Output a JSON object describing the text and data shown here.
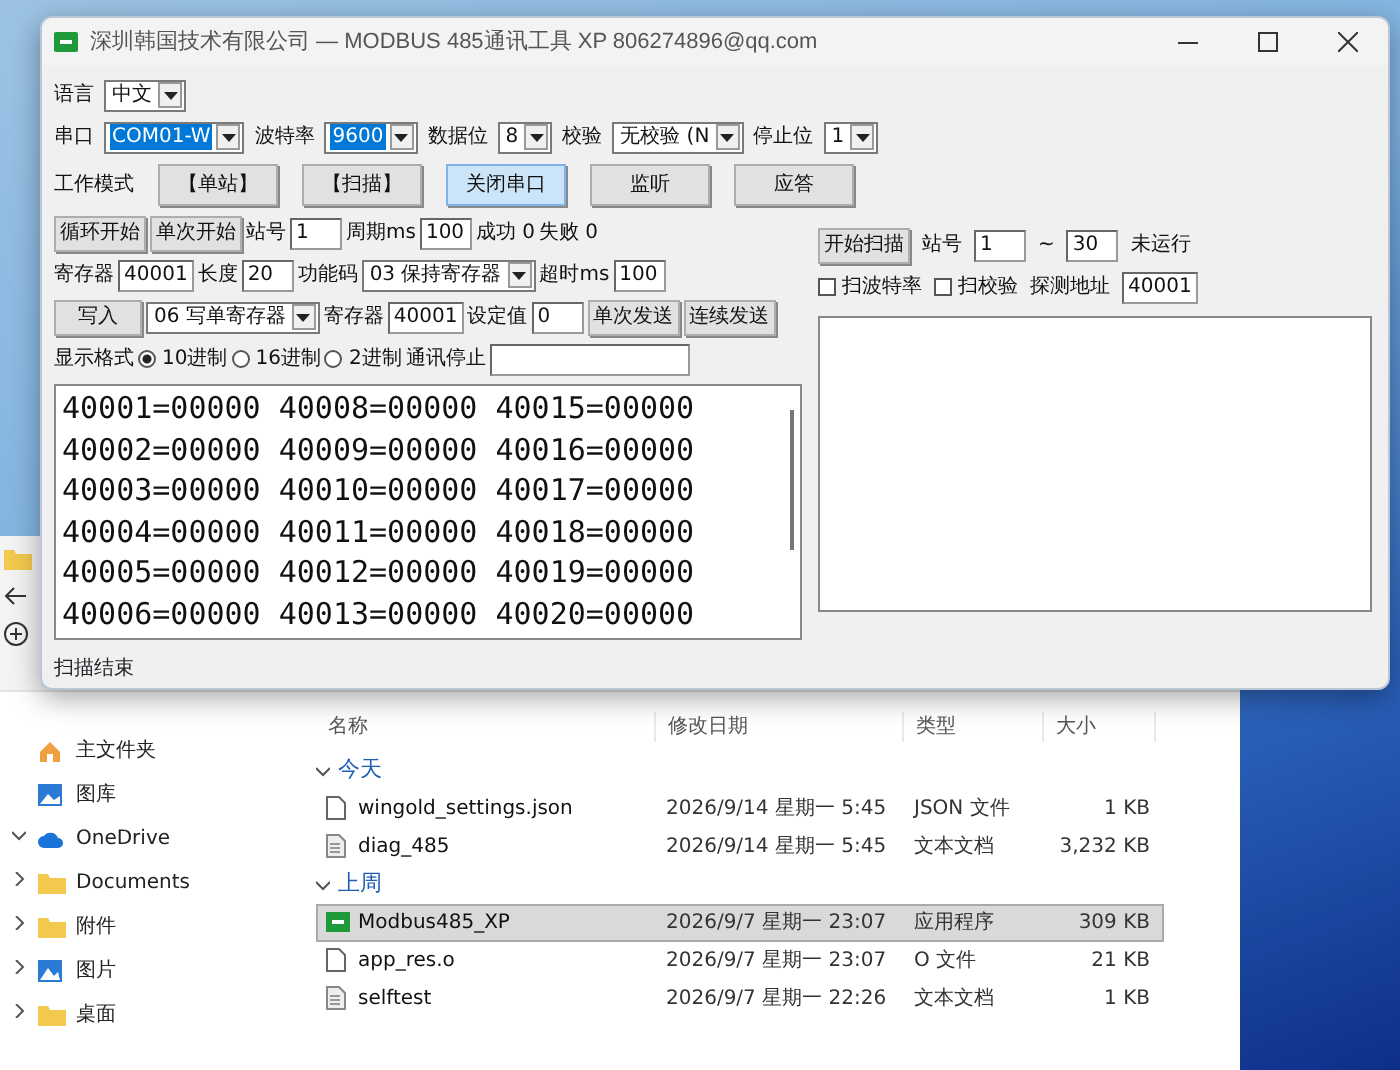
{
  "window": {
    "title": "深圳韩国技术有限公司 — MODBUS 485通讯工具 XP  806274896@qq.com"
  },
  "top_rows": [
    [
      {
        "kind": "label",
        "label": "语言"
      },
      {
        "kind": "select",
        "value": "中文",
        "text_selected": false
      }
    ],
    [
      {
        "kind": "label",
        "label": "串口"
      },
      {
        "kind": "select",
        "value": "COM01-W",
        "text_selected": true
      },
      {
        "kind": "label",
        "label": "波特率"
      },
      {
        "kind": "select",
        "value": "9600",
        "text_selected": true
      },
      {
        "kind": "label",
        "label": "数据位"
      },
      {
        "kind": "select",
        "value": "8",
        "text_selected": false
      },
      {
        "kind": "label",
        "label": "校验"
      },
      {
        "kind": "select",
        "value": "无校验 (N",
        "text_selected": false
      },
      {
        "kind": "label",
        "label": "停止位"
      },
      {
        "kind": "select",
        "value": "1",
        "text_selected": false
      }
    ],
    [
      {
        "kind": "label",
        "label": "工作模式"
      },
      {
        "kind": "button",
        "label": "【单站】",
        "selected": false
      },
      {
        "kind": "button",
        "label": "【扫描】",
        "selected": false
      },
      {
        "kind": "button",
        "label": "关闭串口",
        "selected": true
      },
      {
        "kind": "button",
        "label": "监听",
        "selected": false
      },
      {
        "kind": "button",
        "label": "应答",
        "selected": false
      }
    ]
  ],
  "left_rows": [
    [
      {
        "kind": "button",
        "label": "循环开始"
      },
      {
        "kind": "button",
        "label": "单次开始"
      },
      {
        "kind": "label",
        "label": "站号"
      },
      {
        "kind": "input",
        "value": "1"
      },
      {
        "kind": "label",
        "label": "周期ms"
      },
      {
        "kind": "input",
        "value": "100"
      },
      {
        "kind": "text",
        "label": "成功 0"
      },
      {
        "kind": "text",
        "label": "失败 0"
      }
    ],
    [
      {
        "kind": "label",
        "label": "寄存器"
      },
      {
        "kind": "input",
        "value": "40001"
      },
      {
        "kind": "label",
        "label": "长度"
      },
      {
        "kind": "input",
        "value": "20"
      },
      {
        "kind": "label",
        "label": "功能码"
      },
      {
        "kind": "select",
        "value": "03 保持寄存器",
        "text_selected": false
      },
      {
        "kind": "label",
        "label": "超时ms"
      },
      {
        "kind": "input",
        "value": "100"
      }
    ],
    [
      {
        "kind": "button",
        "label": "写入"
      },
      {
        "kind": "select",
        "value": "06 写单寄存器",
        "text_selected": false
      },
      {
        "kind": "label",
        "label": "寄存器"
      },
      {
        "kind": "input",
        "value": "40001"
      },
      {
        "kind": "label",
        "label": "设定值"
      },
      {
        "kind": "input",
        "value": "0"
      },
      {
        "kind": "button",
        "label": "单次发送"
      },
      {
        "kind": "button",
        "label": "连续发送"
      }
    ],
    [
      {
        "kind": "label",
        "label": "显示格式"
      },
      {
        "kind": "radio",
        "label": "10进制",
        "selected": true
      },
      {
        "kind": "radio",
        "label": "16进制",
        "selected": false
      },
      {
        "kind": "radio",
        "label": "2进制",
        "selected": false
      },
      {
        "kind": "text",
        "label": "通讯停止"
      },
      {
        "kind": "input"
      }
    ]
  ],
  "output": {
    "lines": [
      "40001=00000 40008=00000 40015=00000",
      "40002=00000 40009=00000 40016=00000",
      "40003=00000 40010=00000 40017=00000",
      "40004=00000 40011=00000 40018=00000",
      "40005=00000 40012=00000 40019=00000",
      "40006=00000 40013=00000 40020=00000"
    ]
  },
  "right_rows": [
    [
      {
        "kind": "button",
        "label": "开始扫描"
      },
      {
        "kind": "label",
        "label": "站号"
      },
      {
        "kind": "input",
        "value": "1"
      },
      {
        "kind": "label",
        "label": "~"
      },
      {
        "kind": "input",
        "value": "30"
      },
      {
        "kind": "text",
        "label": "未运行"
      }
    ],
    [
      {
        "kind": "checkbox",
        "label": "扫波特率",
        "checked": false
      },
      {
        "kind": "checkbox",
        "label": "扫校验",
        "checked": false
      },
      {
        "kind": "label",
        "label": "探测地址"
      },
      {
        "kind": "input",
        "value": "40001"
      }
    ]
  ],
  "status_bar": "扫描结束",
  "explorer": {
    "nav": [
      {
        "label": "主文件夹",
        "kind": "home"
      },
      {
        "label": "图库",
        "kind": "gallery"
      },
      {
        "label": "OneDrive",
        "kind": "cloud",
        "expanded": true
      },
      {
        "label": "Documents",
        "kind": "folder",
        "expanded": false
      },
      {
        "label": "附件",
        "kind": "folder",
        "expanded": false
      },
      {
        "label": "图片",
        "kind": "pictures",
        "expanded": false
      },
      {
        "label": "桌面",
        "kind": "folder",
        "expanded": false
      }
    ],
    "columns": [
      "名称",
      "修改日期",
      "类型",
      "大小"
    ],
    "groups": [
      {
        "label": "今天",
        "expanded": true,
        "files": [
          {
            "name": "wingold_settings.json",
            "date": "2026/9/14 星期一 5:45",
            "type": "JSON 文件",
            "size": "1 KB",
            "kind": "file",
            "selected": false
          },
          {
            "name": "diag_485",
            "date": "2026/9/14 星期一 5:45",
            "type": "文本文档",
            "size": "3,232 KB",
            "kind": "text",
            "selected": false
          }
        ]
      },
      {
        "label": "上周",
        "expanded": true,
        "files": [
          {
            "name": "Modbus485_XP",
            "date": "2026/9/7 星期一 23:07",
            "type": "应用程序",
            "size": "309 KB",
            "kind": "app",
            "selected": true
          },
          {
            "name": "app_res.o",
            "date": "2026/9/7 星期一 23:07",
            "type": "O 文件",
            "size": "21 KB",
            "kind": "file",
            "selected": false
          },
          {
            "name": "selftest",
            "date": "2026/9/7 星期一 22:26",
            "type": "文本文档",
            "size": "1 KB",
            "kind": "text",
            "selected": false
          }
        ]
      }
    ]
  }
}
